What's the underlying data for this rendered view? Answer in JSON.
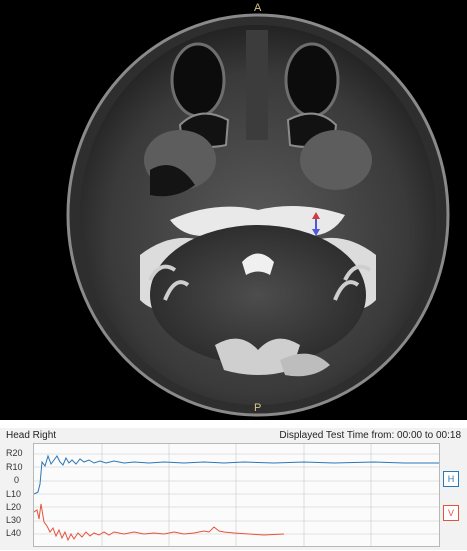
{
  "mri": {
    "anterior_label": "A",
    "posterior_label": "P",
    "marker_color": "#4e59d8"
  },
  "trace": {
    "title": "Head Right",
    "time_label": "Displayed Test Time from: 00:00 to 00:18",
    "y_labels": [
      "R20",
      "R10",
      "0",
      "L10",
      "L20",
      "L30",
      "L40"
    ],
    "legend_h": "H",
    "legend_v": "V",
    "colors": {
      "h": "#2a77b8",
      "v": "#e5533c",
      "grid": "#c9c9c9"
    }
  }
}
